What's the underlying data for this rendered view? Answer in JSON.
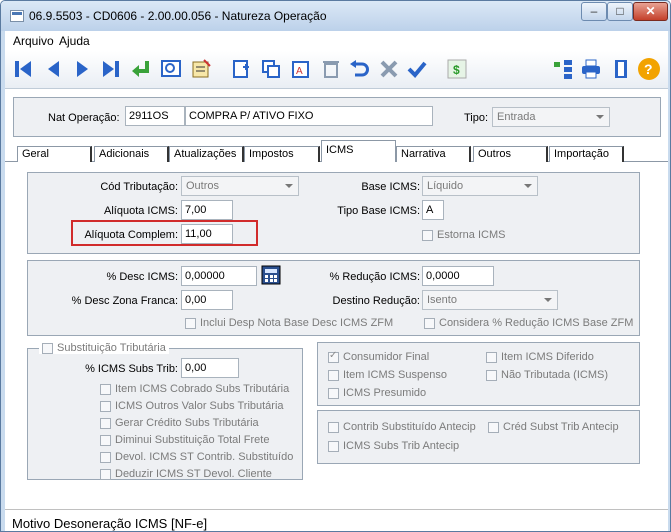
{
  "window": {
    "title": "06.9.5503 - CD0606 - 2.00.00.056 - Natureza Operação"
  },
  "menu": {
    "arquivo": "Arquivo",
    "ajuda": "Ajuda"
  },
  "toolbar": {
    "icons": [
      "first-record-icon",
      "previous-record-icon",
      "next-record-icon",
      "last-record-icon",
      "return-icon",
      "search-icon",
      "edit-list-icon",
      "new-record-icon",
      "copy-icon",
      "edit-icon",
      "delete-icon",
      "undo-icon",
      "cancel-icon",
      "confirm-icon",
      "currency-icon",
      "tree-icon",
      "print-icon",
      "exit-icon",
      "help-icon"
    ]
  },
  "header": {
    "nat_operacao_label": "Nat Operação:",
    "nat_operacao_code": "2911OS",
    "nat_operacao_desc": "COMPRA P/ ATIVO FIXO",
    "tipo_label": "Tipo:",
    "tipo_value": "Entrada"
  },
  "tabs": [
    "Geral",
    "Adicionais",
    "Atualizações",
    "Impostos",
    "ICMS",
    "Narrativa",
    "Outros",
    "Importação"
  ],
  "icms": {
    "cod_trib_label": "Cód Tributação:",
    "cod_trib_value": "Outros",
    "base_icms_label": "Base ICMS:",
    "base_icms_value": "Líquido",
    "aliquota_label": "Alíquota ICMS:",
    "aliquota_value": "7,00",
    "tipo_base_label": "Tipo Base ICMS:",
    "tipo_base_value": "A",
    "aliq_complem_label": "Alíquota Complem:",
    "aliq_complem_value": "11,00",
    "estorna_label": "Estorna ICMS",
    "desc_icms_label": "% Desc ICMS:",
    "desc_icms_value": "0,00000",
    "reducao_label": "% Redução ICMS:",
    "reducao_value": "0,0000",
    "desc_zf_label": "% Desc Zona Franca:",
    "desc_zf_value": "0,00",
    "destino_label": "Destino Redução:",
    "destino_value": "Isento",
    "inclui_desp_label": "Inclui Desp Nota Base Desc ICMS ZFM",
    "considera_label": "Considera % Redução ICMS Base ZFM",
    "subst_trib_label": "Substituição Tributária",
    "icms_subs_label": "% ICMS Subs Trib:",
    "icms_subs_value": "0,00",
    "subst_items": [
      "Item ICMS Cobrado Subs Tributária",
      "ICMS Outros Valor Subs Tributária",
      "Gerar Crédito Subs Tributária",
      "Diminui Substituição Total Frete",
      "Devol. ICMS ST Contrib. Substituído",
      "Deduzir ICMS ST Devol. Cliente"
    ],
    "consumidor_final": "Consumidor Final",
    "item_diferido": "Item ICMS Diferido",
    "item_suspenso": "Item ICMS Suspenso",
    "nao_tributada": "Não Tributada (ICMS)",
    "icms_presumido": "ICMS Presumido",
    "contrib_antecip": "Contrib Substituído Antecip",
    "cred_antecip": "Créd Subst Trib Antecip",
    "icms_subs_antecip": "ICMS Subs Trib Antecip"
  },
  "status": {
    "text": "Motivo Desoneração ICMS [NF-e]"
  },
  "colors": {
    "titlebar": "#c9dbee",
    "highlight": "#d12b2b",
    "panel": "#eef0f3"
  }
}
